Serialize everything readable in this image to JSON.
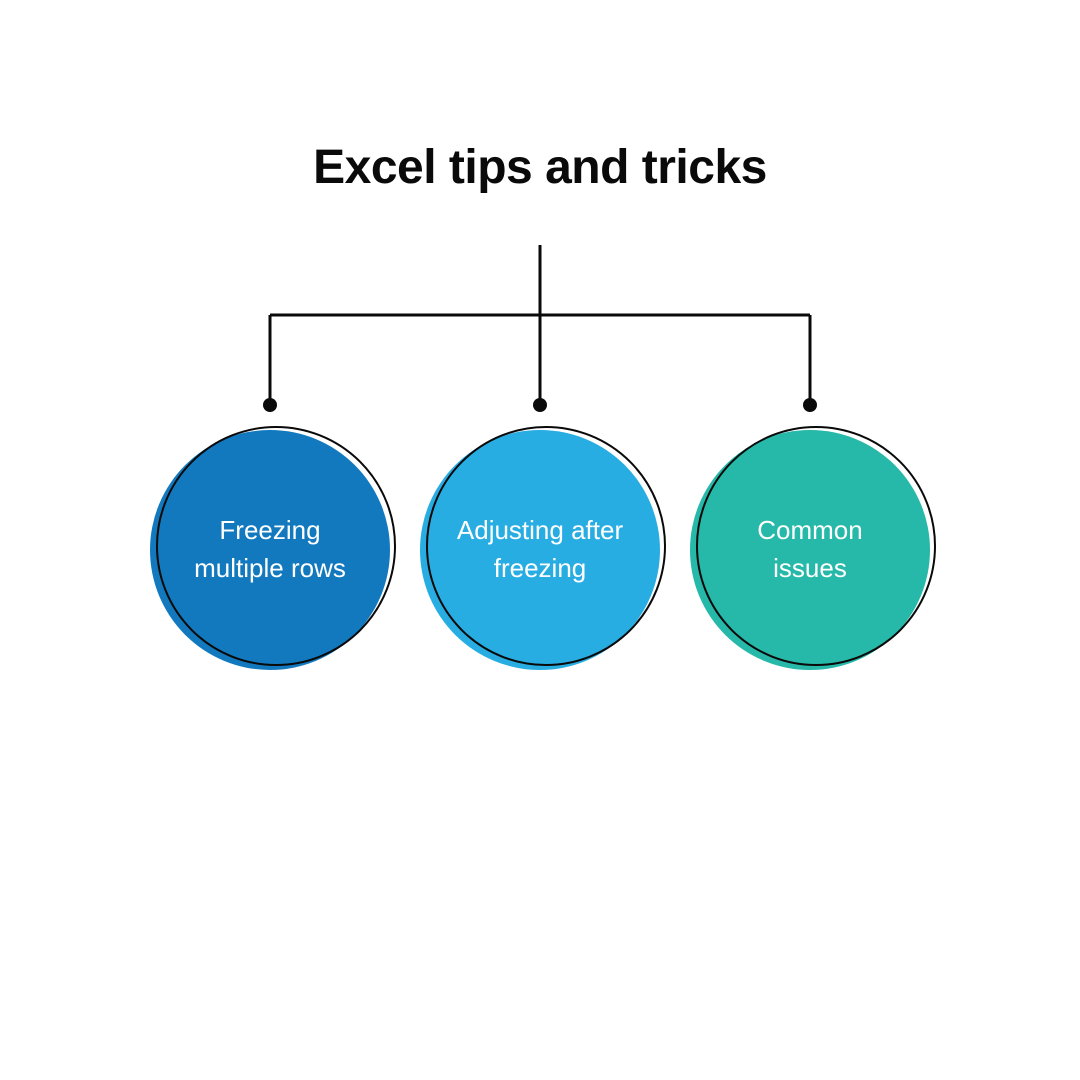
{
  "title": "Excel tips and tricks",
  "nodes": [
    {
      "label": "Freezing multiple rows",
      "color": "#1279BF"
    },
    {
      "label": "Adjusting after freezing",
      "color": "#28ADE3"
    },
    {
      "label": "Common issues",
      "color": "#26B8A8"
    }
  ],
  "connector": {
    "stroke": "#0a0a0a",
    "dotRadius": 7
  }
}
